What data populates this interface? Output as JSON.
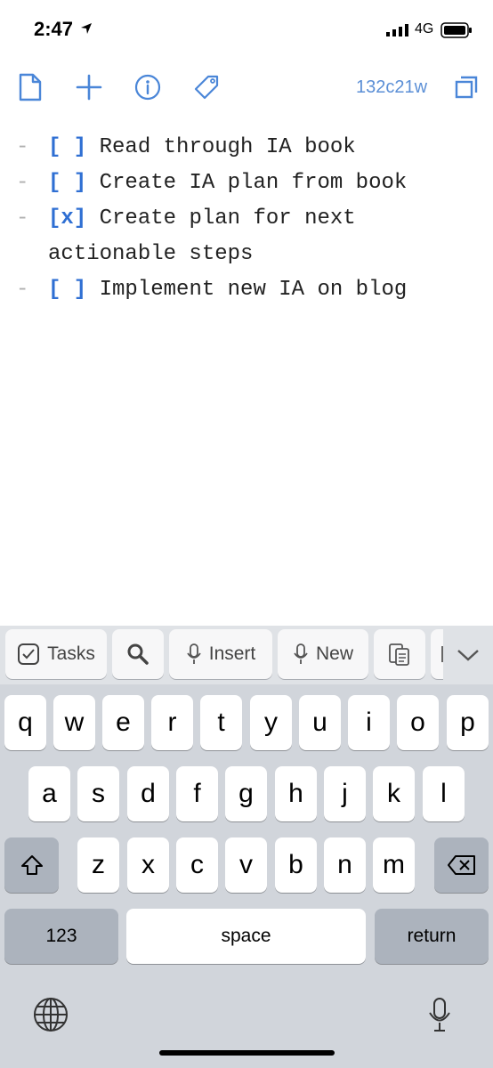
{
  "status": {
    "time": "2:47",
    "network": "4G"
  },
  "toolbar": {
    "doc_id": "132c21w"
  },
  "editor": {
    "lines": [
      {
        "dash": "-",
        "box": "[ ]",
        "text": "Read through IA book"
      },
      {
        "dash": "-",
        "box": "[ ]",
        "text": "Create IA plan from book"
      },
      {
        "dash": "-",
        "box": "[x]",
        "text": "Create plan for next actionable steps"
      },
      {
        "dash": "-",
        "box": "[ ]",
        "text": "Implement new IA on blog"
      }
    ]
  },
  "accessory": {
    "tasks": "Tasks",
    "insert": "Insert",
    "new": "New"
  },
  "keyboard": {
    "row1": [
      "q",
      "w",
      "e",
      "r",
      "t",
      "y",
      "u",
      "i",
      "o",
      "p"
    ],
    "row2": [
      "a",
      "s",
      "d",
      "f",
      "g",
      "h",
      "j",
      "k",
      "l"
    ],
    "row3": [
      "z",
      "x",
      "c",
      "v",
      "b",
      "n",
      "m"
    ],
    "numbers": "123",
    "space": "space",
    "return": "return"
  },
  "colors": {
    "accent": "#2f6fd3",
    "icon_blue": "#4a86d8"
  }
}
